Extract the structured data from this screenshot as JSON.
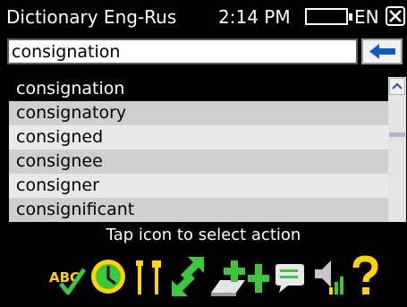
{
  "title_bar": {
    "app_title": "Dictionary Eng-Rus",
    "time": "2:14 PM",
    "language": "EN"
  },
  "search": {
    "value": "consignation"
  },
  "word_list": {
    "items": [
      {
        "label": "consignation",
        "selected": true
      },
      {
        "label": "consignatory",
        "selected": false
      },
      {
        "label": "consigned",
        "selected": false
      },
      {
        "label": "consignee",
        "selected": false
      },
      {
        "label": "consigner",
        "selected": false
      },
      {
        "label": "consignificant",
        "selected": false
      }
    ]
  },
  "hint": "Tap icon to select action",
  "toolbar": {
    "icons": [
      "spellcheck-icon",
      "history-icon",
      "tools-icon",
      "swap-icon",
      "add-card-icon",
      "add-icon",
      "comment-icon",
      "speaker-icon",
      "help-icon"
    ],
    "spellcheck_text": "ABC"
  },
  "colors": {
    "background": "#000000",
    "list_odd": "#e9e9e9",
    "list_even": "#cfcfcf",
    "selected": "#000000",
    "accent_green": "#3cc83c",
    "accent_blue": "#0a5cc7",
    "accent_yellow": "#ffd400"
  }
}
